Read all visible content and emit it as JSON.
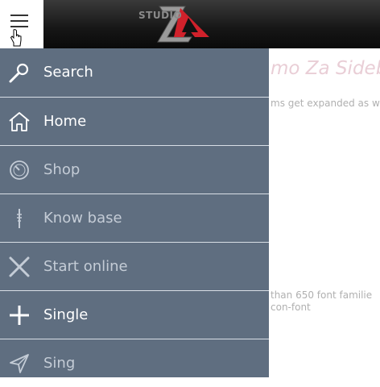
{
  "header": {
    "logo_text": "STUDIO",
    "logo_mark": "ZA"
  },
  "background": {
    "title": "mo Za Sidebar",
    "line1": "ms get expanded as we",
    "line2": "than 650 font familie",
    "line3": "con-font"
  },
  "sidebar": {
    "items": [
      {
        "label": "Search",
        "icon": "search-icon",
        "state": "active"
      },
      {
        "label": "Home",
        "icon": "home-icon",
        "state": "active"
      },
      {
        "label": "Shop",
        "icon": "clock-icon",
        "state": "dim"
      },
      {
        "label": "Know base",
        "icon": "pencil-icon",
        "state": "dim"
      },
      {
        "label": "Start online",
        "icon": "cross-icon",
        "state": "dim"
      },
      {
        "label": "Single",
        "icon": "plus-icon",
        "state": "active"
      },
      {
        "label": "Sing",
        "icon": "send-icon",
        "state": "dim"
      }
    ]
  },
  "colors": {
    "sidebar_bg": "#5f6e80",
    "separator": "#d8dee6",
    "logo_accent": "#d0212b"
  }
}
